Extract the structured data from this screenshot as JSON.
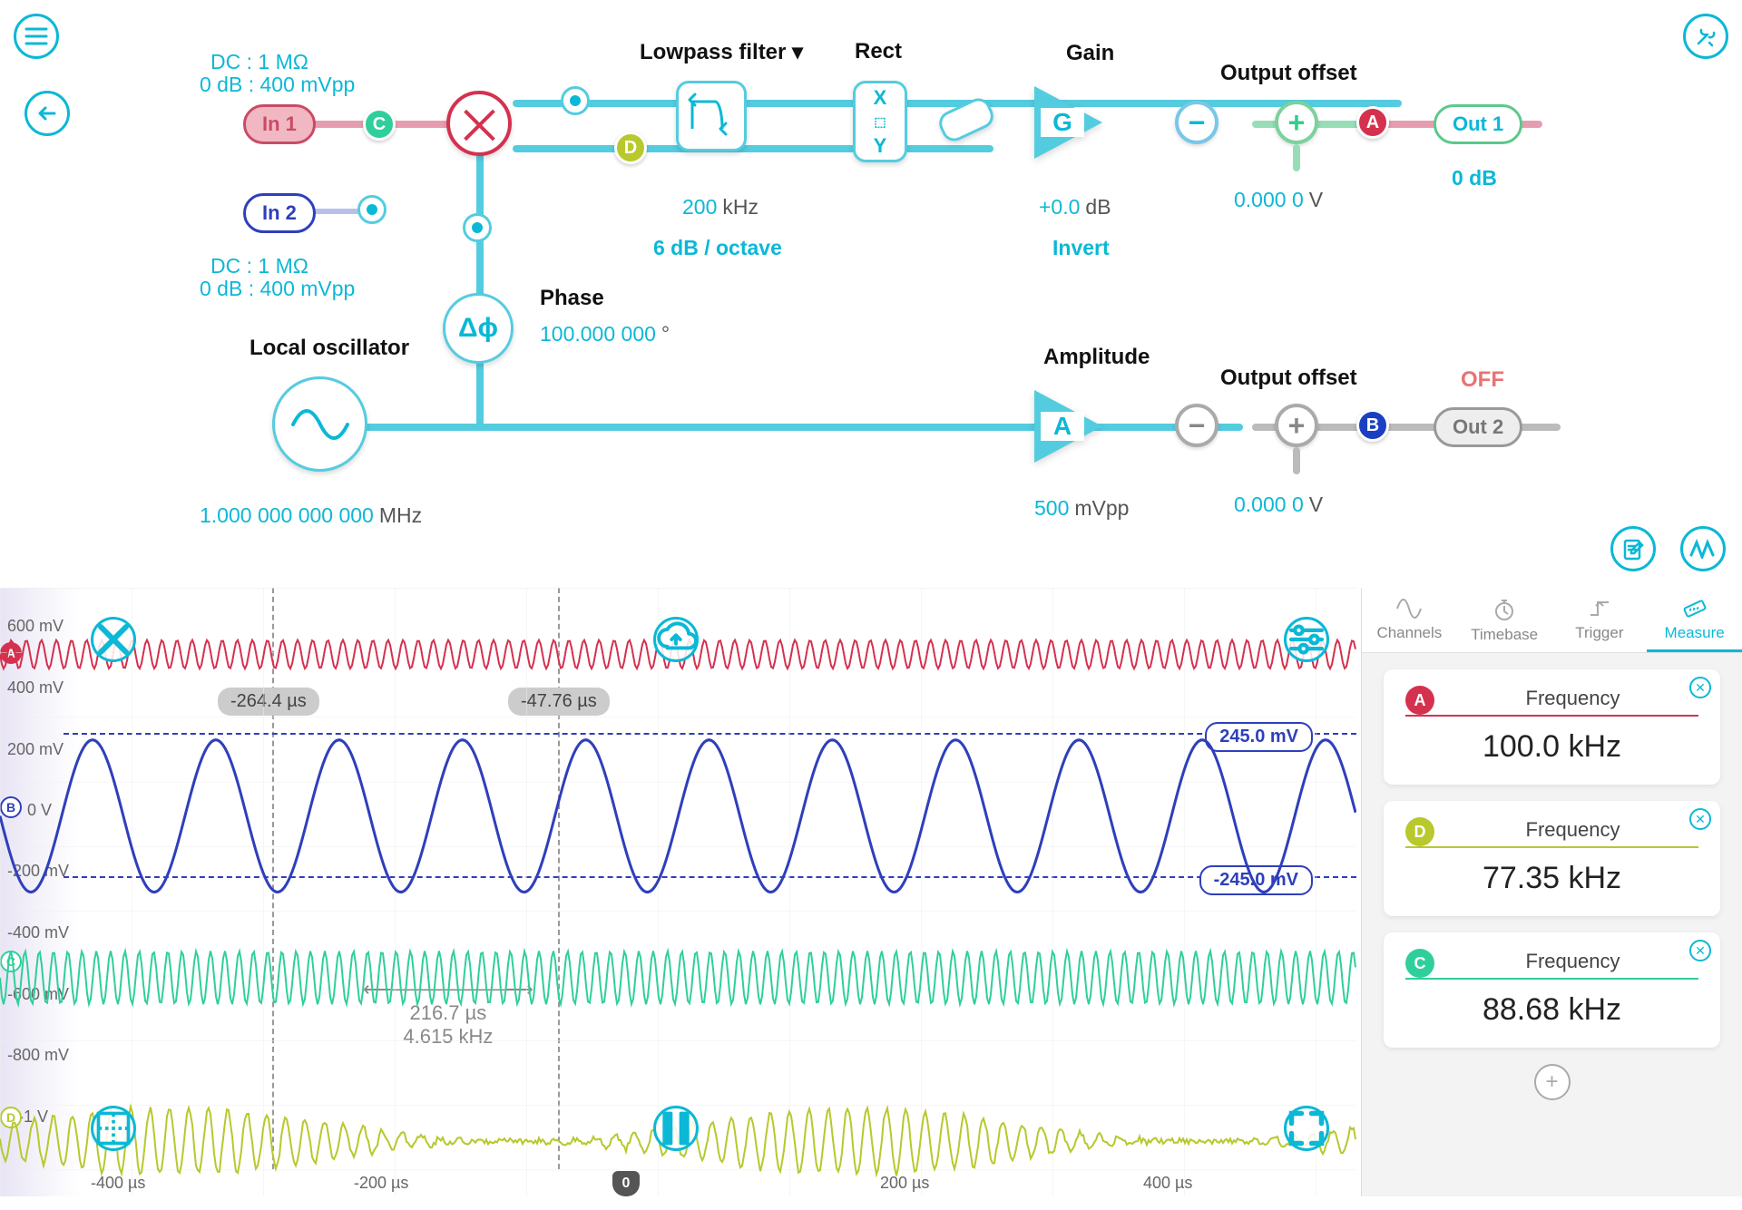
{
  "header": {
    "dc1": "DC : 1 MΩ",
    "db1": "0 dB : 400 mVpp",
    "dc2": "DC : 1 MΩ",
    "db2": "0 dB : 400 mVpp"
  },
  "ports": {
    "in1": "In 1",
    "in2": "In 2",
    "out1": "Out 1",
    "out1_db": "0 dB",
    "out2": "Out 2",
    "out2_state": "OFF"
  },
  "blocks": {
    "lowpass_title": "Lowpass filter ▾",
    "lowpass_freq": "200",
    "lowpass_unit": "kHz",
    "lowpass_slope": "6 dB / octave",
    "rect_title": "Rect",
    "rect_x": "X",
    "rect_y": "Y",
    "gain_title": "Gain",
    "gain_val": "+0.0",
    "gain_unit": "dB",
    "gain_invert": "Invert",
    "offset1_title": "Output offset",
    "offset1_val": "0.000 0",
    "offset1_unit": "V",
    "phase_title": "Phase",
    "phase_val": "100.000 000",
    "phase_unit": "°",
    "lo_title": "Local oscillator",
    "lo_val": "1.000 000 000 000",
    "lo_unit": "MHz",
    "amp_title": "Amplitude",
    "amp_val": "500",
    "amp_unit": "mVpp",
    "offset2_title": "Output offset",
    "offset2_val": "0.000 0",
    "offset2_unit": "V",
    "delta_phi": "Δϕ",
    "G": "G",
    "A": "A"
  },
  "scope": {
    "y": [
      "600 mV",
      "400 mV",
      "200 mV",
      "0 V",
      "-200 mV",
      "-400 mV",
      "-600 mV",
      "-800 mV",
      "-1 V"
    ],
    "x": [
      "-400 µs",
      "-200 µs",
      "200 µs",
      "400 µs"
    ],
    "cursors": {
      "t1": "-264.4 µs",
      "t2": "-47.76 µs",
      "dt": "216.7 µs",
      "f": "4.615 kHz"
    },
    "markers": {
      "pos": "245.0 mV",
      "neg": "-245.0 mV"
    },
    "origin": "0"
  },
  "tabs": [
    "Channels",
    "Timebase",
    "Trigger",
    "Measure"
  ],
  "measurements": [
    {
      "ch": "A",
      "title": "Frequency",
      "value": "100.0 kHz"
    },
    {
      "ch": "D",
      "title": "Frequency",
      "value": "77.35 kHz"
    },
    {
      "ch": "C",
      "title": "Frequency",
      "value": "88.68 kHz"
    }
  ]
}
